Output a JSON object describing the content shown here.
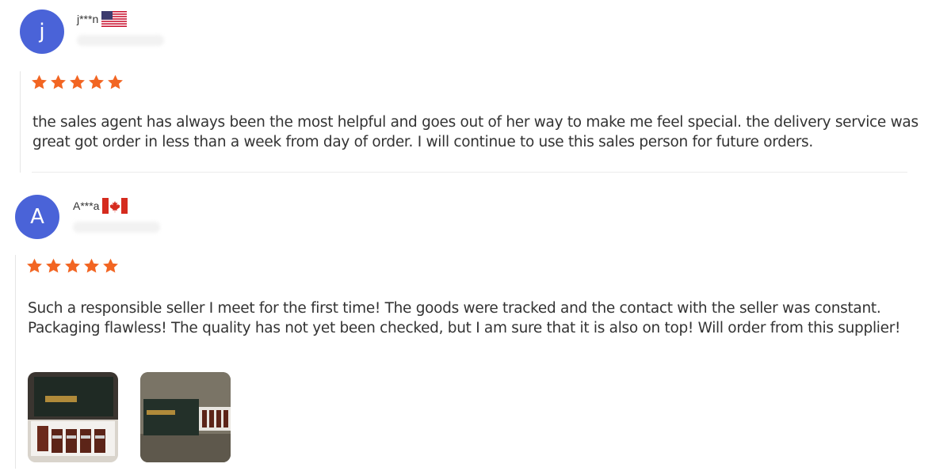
{
  "reviews": [
    {
      "avatar_letter": "j",
      "username": "j***n",
      "country": "United States",
      "rating": 5,
      "text": "the sales agent has always been the most helpful and goes out of her way to make me feel special. the delivery service was great got order in less than a week from day of order. I will continue to use this sales person for future orders."
    },
    {
      "avatar_letter": "A",
      "username": "A***a",
      "country": "Canada",
      "rating": 5,
      "text": "Such a responsible seller I meet for the first time! The goods were tracked and the contact with the seller was constant. Packaging flawless! The quality has not yet been checked, but I am sure that it is also on top! Will order from this supplier!"
    }
  ],
  "colors": {
    "avatar": "#4a63d8",
    "star": "#f26522",
    "text": "#333333"
  },
  "icons": {
    "star": "star-icon",
    "flag_us": "us-flag-icon",
    "flag_ca": "canada-flag-icon"
  }
}
